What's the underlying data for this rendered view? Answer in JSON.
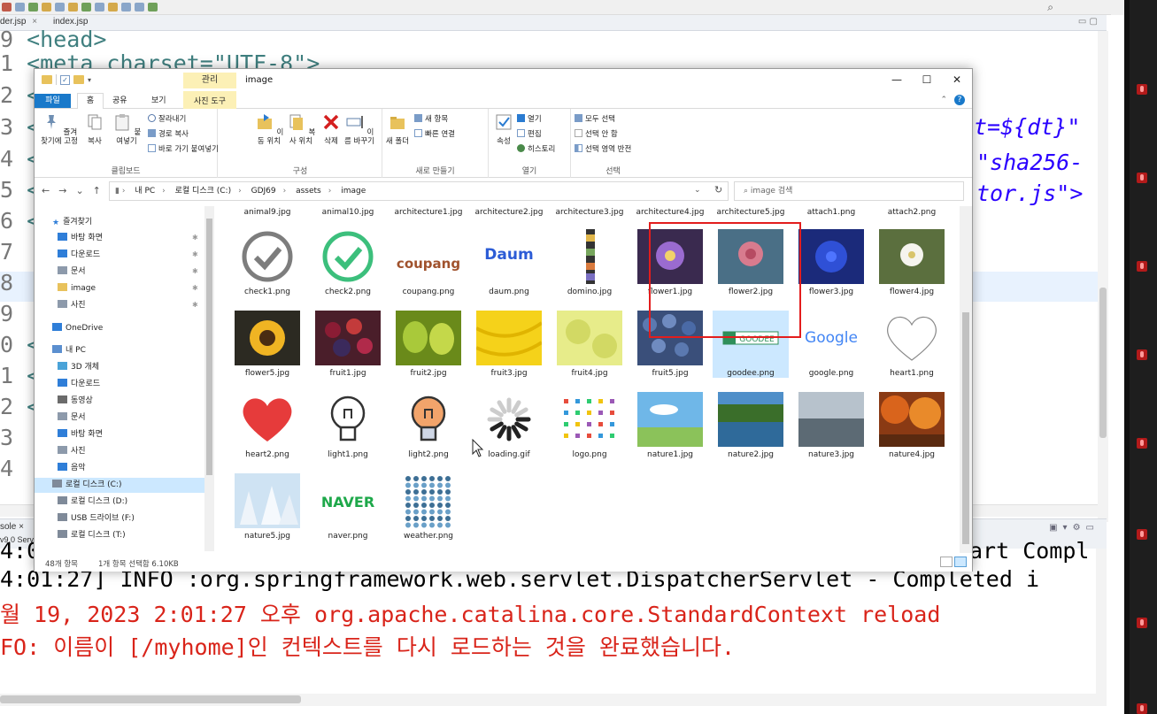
{
  "eclipse": {
    "editor_tabs": [
      {
        "label": "der.jsp",
        "close": "×"
      },
      {
        "label": "index.jsp"
      }
    ],
    "code_lines": [
      {
        "gutter": "9",
        "text": "<head>"
      },
      {
        "gutter": "1",
        "text": "<meta charset=\"UTF-8\">"
      },
      {
        "gutter": "2",
        "text": "<t"
      },
      {
        "gutter": "3",
        "text": "<l"
      },
      {
        "gutter": "4",
        "text": "<s"
      },
      {
        "gutter": "5",
        "text": "<s"
      },
      {
        "gutter": "6",
        "text": "<s"
      },
      {
        "gutter": "7",
        "text": ""
      },
      {
        "gutter": "8",
        "text": ""
      },
      {
        "gutter": "9",
        "text": ""
      },
      {
        "gutter": "0",
        "text": "</"
      },
      {
        "gutter": "1",
        "text": "</"
      },
      {
        "gutter": "2",
        "text": "<b"
      },
      {
        "gutter": "3",
        "text": ""
      },
      {
        "gutter": "4",
        "text": ""
      }
    ],
    "code_fragments": {
      "line3_right": "t=${dt}\"",
      "line4_right": "\"sha256-",
      "line5_right": "tor.js\">"
    },
    "console_tabs": {
      "console": "sole ×",
      "server": "v9.0 Serv"
    },
    "console_lines": [
      {
        "text": "4:0",
        "tail": "art Compl",
        "color": "black"
      },
      {
        "text": "4:01:27] INFO :org.springframework.web.servlet.DispatcherServlet - Completed i",
        "color": "black"
      },
      {
        "text": "월 19, 2023 2:01:27 오후 org.apache.catalina.core.StandardContext reload",
        "color": "red"
      },
      {
        "text": "FO: 이름이 [/myhome]인 컨텍스트를 다시 로드하는 것을 완료했습니다.",
        "color": "red"
      }
    ]
  },
  "explorer": {
    "title": "image",
    "context_tab_label": "관리",
    "window_controls": [
      "—",
      "☐",
      "✕"
    ],
    "ribbon_tabs": {
      "file": "파일",
      "home": "홈",
      "share": "공유",
      "view": "보기",
      "picture_tools": "사진 도구"
    },
    "ribbon": {
      "clipboard": {
        "label": "클립보드",
        "pin": "즐겨찾기에 고정",
        "copy": "복사",
        "paste": "붙여넣기",
        "cut": "잘라내기",
        "copy_path": "경로 복사",
        "paste_shortcut": "바로 가기 붙여넣기"
      },
      "organize": {
        "label": "구성",
        "move_to": "이동 위치",
        "copy_to": "복사 위치",
        "delete": "삭제",
        "rename": "이름 바꾸기"
      },
      "new": {
        "label": "새로 만들기",
        "new_folder": "새 폴더",
        "new_item": "새 항목",
        "easy_access": "빠른 연결"
      },
      "open": {
        "label": "열기",
        "properties": "속성",
        "open": "열기",
        "edit": "편집",
        "history": "히스토리"
      },
      "select": {
        "label": "선택",
        "select_all": "모두 선택",
        "select_none": "선택 안 함",
        "invert": "선택 영역 반전"
      }
    },
    "address": {
      "crumbs": [
        "내 PC",
        "로컬 디스크 (C:)",
        "GDJ69",
        "assets",
        "image"
      ],
      "search_placeholder": "image 검색"
    },
    "nav": [
      {
        "label": "즐겨찾기",
        "icon": "star-icon",
        "level": 0
      },
      {
        "label": "바탕 화면",
        "icon": "desktop-icon",
        "level": 1
      },
      {
        "label": "다운로드",
        "icon": "download-icon",
        "level": 1
      },
      {
        "label": "문서",
        "icon": "document-icon",
        "level": 1
      },
      {
        "label": "image",
        "icon": "folder-icon",
        "level": 1
      },
      {
        "label": "사진",
        "icon": "picture-icon",
        "level": 1
      },
      {
        "label": "OneDrive",
        "icon": "cloud-icon",
        "level": 0
      },
      {
        "label": "내 PC",
        "icon": "computer-icon",
        "level": 0
      },
      {
        "label": "3D 개체",
        "icon": "cube-icon",
        "level": 1
      },
      {
        "label": "다운로드",
        "icon": "download-icon",
        "level": 1
      },
      {
        "label": "동영상",
        "icon": "video-icon",
        "level": 1
      },
      {
        "label": "문서",
        "icon": "document-icon",
        "level": 1
      },
      {
        "label": "바탕 화면",
        "icon": "desktop-icon",
        "level": 1
      },
      {
        "label": "사진",
        "icon": "picture-icon",
        "level": 1
      },
      {
        "label": "음악",
        "icon": "music-icon",
        "level": 1
      },
      {
        "label": "로컬 디스크 (C:)",
        "icon": "drive-icon",
        "level": 1,
        "selected": true
      },
      {
        "label": "로컬 디스크 (D:)",
        "icon": "drive-icon",
        "level": 1
      },
      {
        "label": "USB 드라이브 (F:)",
        "icon": "drive-icon",
        "level": 1
      },
      {
        "label": "로컬 디스크 (T:)",
        "icon": "drive-icon",
        "level": 1
      }
    ],
    "files_top_row": [
      "animal9.jpg",
      "animal10.jpg",
      "architecture1.jpg",
      "architecture2.jpg",
      "architecture3.jpg",
      "architecture4.jpg",
      "architecture5.jpg",
      "attach1.png",
      "attach2.png"
    ],
    "files": [
      {
        "name": "check1.png",
        "kind": "check-gray"
      },
      {
        "name": "check2.png",
        "kind": "check-green"
      },
      {
        "name": "coupang.png",
        "kind": "coupang",
        "text": "coupang"
      },
      {
        "name": "daum.png",
        "kind": "daum",
        "text": "Daum"
      },
      {
        "name": "domino.jpg",
        "kind": "domino"
      },
      {
        "name": "flower1.jpg",
        "kind": "flower-purple"
      },
      {
        "name": "flower2.jpg",
        "kind": "flower-rose"
      },
      {
        "name": "flower3.jpg",
        "kind": "flower-blue"
      },
      {
        "name": "flower4.jpg",
        "kind": "flower-white"
      },
      {
        "name": "flower5.jpg",
        "kind": "sunflower"
      },
      {
        "name": "fruit1.jpg",
        "kind": "berries"
      },
      {
        "name": "fruit2.jpg",
        "kind": "pears"
      },
      {
        "name": "fruit3.jpg",
        "kind": "bananas"
      },
      {
        "name": "fruit4.jpg",
        "kind": "lime"
      },
      {
        "name": "fruit5.jpg",
        "kind": "blueberries"
      },
      {
        "name": "goodee.png",
        "kind": "goodee",
        "text": "GOODEE",
        "selected": true
      },
      {
        "name": "google.png",
        "kind": "google",
        "text": "Google"
      },
      {
        "name": "heart1.png",
        "kind": "heart-outline"
      },
      {
        "name": "heart2.png",
        "kind": "heart-red"
      },
      {
        "name": "light1.png",
        "kind": "bulb-off"
      },
      {
        "name": "light2.png",
        "kind": "bulb-on"
      },
      {
        "name": "loading.gif",
        "kind": "loading"
      },
      {
        "name": "logo.png",
        "kind": "logo-grid"
      },
      {
        "name": "nature1.jpg",
        "kind": "nature-sky"
      },
      {
        "name": "nature2.jpg",
        "kind": "nature-lake"
      },
      {
        "name": "nature3.jpg",
        "kind": "nature-fog"
      },
      {
        "name": "nature4.jpg",
        "kind": "nature-autumn"
      },
      {
        "name": "nature5.jpg",
        "kind": "nature-snow"
      },
      {
        "name": "naver.png",
        "kind": "naver",
        "text": "NAVER"
      },
      {
        "name": "weather.png",
        "kind": "weather-grid"
      }
    ],
    "status": {
      "count": "48개 항목",
      "selection": "1개 항목 선택함 6.10KB"
    }
  },
  "colors": {
    "highlight_box": "#e31d1d",
    "selection": "#cce8ff",
    "file_tab": "#1979ca",
    "context_tab": "#fcf0b6",
    "console_red": "#d9241a"
  }
}
